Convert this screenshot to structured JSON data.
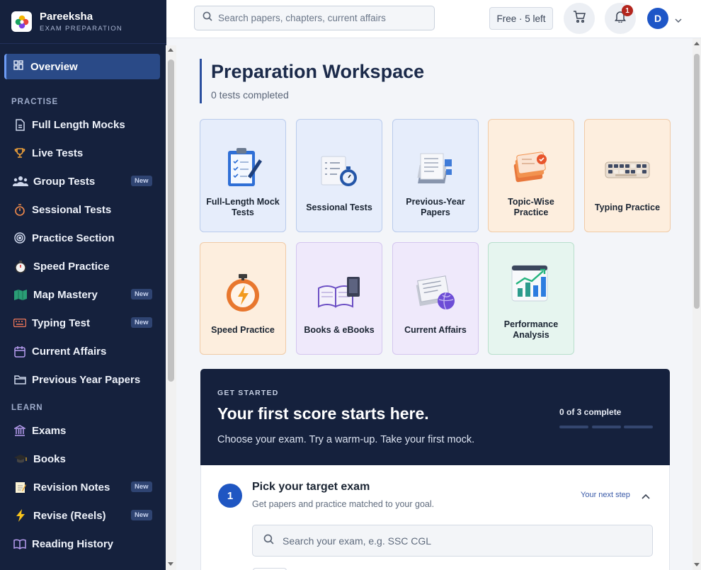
{
  "brand": {
    "name": "Pareeksha",
    "tagline": "EXAM PREPARATION",
    "logo_icon": "flower-logo"
  },
  "sidebar": {
    "active": {
      "label": "Overview",
      "icon": "dashboard-icon"
    },
    "sections": [
      {
        "title": "PRACTISE",
        "items": [
          {
            "label": "Full Length Mocks",
            "icon": "document-icon"
          },
          {
            "label": "Live Tests",
            "icon": "trophy-icon"
          },
          {
            "label": "Group Tests",
            "icon": "group-icon",
            "badge": "New"
          },
          {
            "label": "Sessional Tests",
            "icon": "timer-icon"
          },
          {
            "label": "Practice Section",
            "icon": "target-icon"
          },
          {
            "label": "Speed Practice",
            "icon": "stopwatch-icon"
          },
          {
            "label": "Map Mastery",
            "icon": "map-icon",
            "badge": "New"
          },
          {
            "label": "Typing Test",
            "icon": "keyboard-icon",
            "badge": "New"
          },
          {
            "label": "Current Affairs",
            "icon": "calendar-icon"
          },
          {
            "label": "Previous Year Papers",
            "icon": "folder-icon"
          }
        ]
      },
      {
        "title": "LEARN",
        "items": [
          {
            "label": "Exams",
            "icon": "institution-icon"
          },
          {
            "label": "Books",
            "icon": "graduation-cap-icon"
          },
          {
            "label": "Revision Notes",
            "icon": "notepad-icon",
            "badge": "New"
          },
          {
            "label": "Revise (Reels)",
            "icon": "lightning-icon",
            "badge": "New"
          },
          {
            "label": "Reading History",
            "icon": "book-open-icon"
          }
        ]
      }
    ]
  },
  "topbar": {
    "search_placeholder": "Search papers, chapters, current affairs",
    "plan_label": "Free · 5 left",
    "notification_count": "1",
    "avatar_initial": "D"
  },
  "workspace": {
    "title": "Preparation Workspace",
    "subtitle": "0 tests completed",
    "tiles": [
      {
        "label": "Full-Length Mock Tests",
        "theme": "blue",
        "icon": "clipboard-icon"
      },
      {
        "label": "Sessional Tests",
        "theme": "blue",
        "icon": "checklist-stopwatch-icon"
      },
      {
        "label": "Previous-Year Papers",
        "theme": "blue",
        "icon": "paper-stack-icon"
      },
      {
        "label": "Topic-Wise Practice",
        "theme": "peach",
        "icon": "cards-check-icon"
      },
      {
        "label": "Typing Practice",
        "theme": "peach",
        "icon": "keyboard-icon"
      },
      {
        "label": "Speed Practice",
        "theme": "peach",
        "icon": "stopwatch-bolt-icon"
      },
      {
        "label": "Books & eBooks",
        "theme": "lav",
        "icon": "books-icon"
      },
      {
        "label": "Current Affairs",
        "theme": "lav",
        "icon": "newspaper-globe-icon"
      },
      {
        "label": "Performance Analysis",
        "theme": "mint",
        "icon": "bar-chart-icon"
      }
    ]
  },
  "get_started": {
    "eyebrow": "GET STARTED",
    "title": "Your first score starts here.",
    "description": "Choose your exam. Try a warm-up. Take your first mock.",
    "progress_label": "0 of 3 complete",
    "progress": {
      "done": 0,
      "total": 3
    }
  },
  "step": {
    "number": "1",
    "title": "Pick your target exam",
    "description": "Get papers and practice matched to your goal.",
    "next_label": "Your next step",
    "search_placeholder": "Search your exam, e.g. SSC CGL"
  },
  "colors": {
    "sidebar_bg": "#15213d",
    "accent": "#1f56c2",
    "active_item": "#2a4a87"
  }
}
